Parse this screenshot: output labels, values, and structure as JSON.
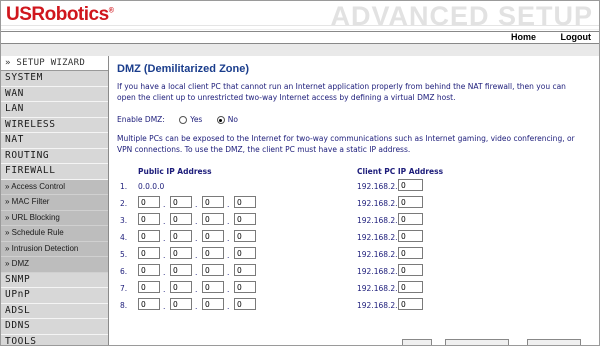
{
  "header": {
    "brand": "USRobotics",
    "brand_mark": "®",
    "section_title": "ADVANCED SETUP"
  },
  "topnav": {
    "home": "Home",
    "logout": "Logout"
  },
  "sidebar": {
    "heading": "» SETUP WIZARD",
    "items": [
      {
        "label": "SYSTEM",
        "type": "main"
      },
      {
        "label": "WAN",
        "type": "main"
      },
      {
        "label": "LAN",
        "type": "main"
      },
      {
        "label": "WIRELESS",
        "type": "main"
      },
      {
        "label": "NAT",
        "type": "main"
      },
      {
        "label": "ROUTING",
        "type": "main"
      },
      {
        "label": "FIREWALL",
        "type": "main"
      },
      {
        "label": "» Access Control",
        "type": "sub"
      },
      {
        "label": "» MAC Filter",
        "type": "sub"
      },
      {
        "label": "» URL Blocking",
        "type": "sub"
      },
      {
        "label": "» Schedule Rule",
        "type": "sub"
      },
      {
        "label": "» Intrusion Detection",
        "type": "sub"
      },
      {
        "label": "» DMZ",
        "type": "sub"
      },
      {
        "label": "SNMP",
        "type": "main"
      },
      {
        "label": "UPnP",
        "type": "main"
      },
      {
        "label": "ADSL",
        "type": "main"
      },
      {
        "label": "DDNS",
        "type": "main"
      },
      {
        "label": "TOOLS",
        "type": "main"
      }
    ]
  },
  "main": {
    "title": "DMZ (Demilitarized Zone)",
    "intro": "If you have a local client PC that cannot run an Internet application properly from behind the NAT firewall, then you can open the client up to unrestricted two-way Internet access by defining a virtual DMZ host.",
    "enable_label": "Enable DMZ:",
    "enable_yes": "Yes",
    "enable_no": "No",
    "enable_selected": "No",
    "info": "Multiple PCs can be exposed to the Internet for two-way communications such as Internet gaming, video conferencing, or VPN connections.  To use the DMZ, the client PC must have a static IP address.",
    "public_ip_header": "Public IP Address",
    "client_ip_header": "Client PC IP Address",
    "client_prefix": "192.168.2.",
    "rows": [
      {
        "num": "1.",
        "public_static": "0.0.0.0",
        "octets": null,
        "client": "0"
      },
      {
        "num": "2.",
        "public_static": null,
        "octets": [
          "0",
          "0",
          "0",
          "0"
        ],
        "client": "0"
      },
      {
        "num": "3.",
        "public_static": null,
        "octets": [
          "0",
          "0",
          "0",
          "0"
        ],
        "client": "0"
      },
      {
        "num": "4.",
        "public_static": null,
        "octets": [
          "0",
          "0",
          "0",
          "0"
        ],
        "client": "0"
      },
      {
        "num": "5.",
        "public_static": null,
        "octets": [
          "0",
          "0",
          "0",
          "0"
        ],
        "client": "0"
      },
      {
        "num": "6.",
        "public_static": null,
        "octets": [
          "0",
          "0",
          "0",
          "0"
        ],
        "client": "0"
      },
      {
        "num": "7.",
        "public_static": null,
        "octets": [
          "0",
          "0",
          "0",
          "0"
        ],
        "client": "0"
      },
      {
        "num": "8.",
        "public_static": null,
        "octets": [
          "0",
          "0",
          "0",
          "0"
        ],
        "client": "0"
      }
    ]
  },
  "colors": {
    "brand_red": "#d0161d",
    "title_blue": "#1a3d8c",
    "text_navy": "#1c1c7a",
    "sidebar_bg": "#d7d7d7",
    "submenu_bg": "#bdbdbd"
  }
}
